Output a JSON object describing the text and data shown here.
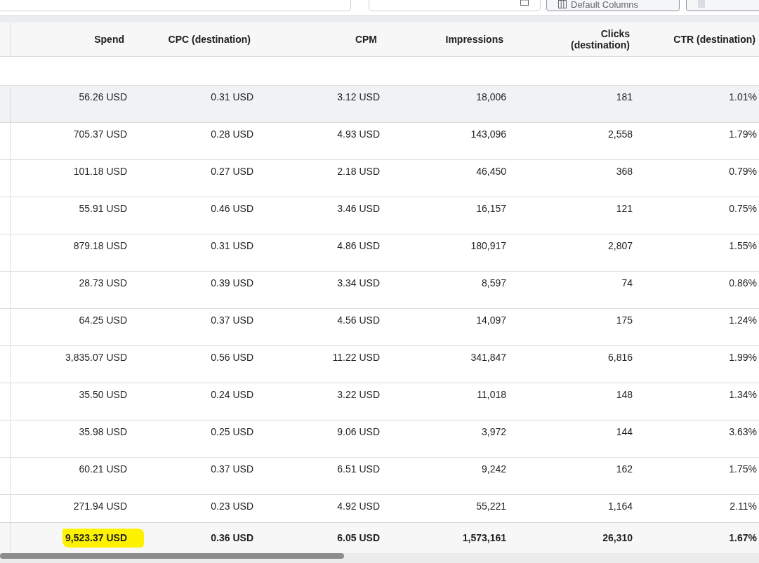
{
  "toolbar": {
    "columns_button": {
      "label": "Default Columns"
    }
  },
  "table": {
    "columns": [
      "Spend",
      "CPC (destination)",
      "CPM",
      "Impressions",
      "Clicks (destination)",
      "CTR (destination)"
    ],
    "rows": [
      {
        "selected": true,
        "cells": [
          "56.26 USD",
          "0.31 USD",
          "3.12 USD",
          "18,006",
          "181",
          "1.01%"
        ]
      },
      {
        "selected": false,
        "cells": [
          "705.37 USD",
          "0.28 USD",
          "4.93 USD",
          "143,096",
          "2,558",
          "1.79%"
        ]
      },
      {
        "selected": false,
        "cells": [
          "101.18 USD",
          "0.27 USD",
          "2.18 USD",
          "46,450",
          "368",
          "0.79%"
        ]
      },
      {
        "selected": false,
        "cells": [
          "55.91 USD",
          "0.46 USD",
          "3.46 USD",
          "16,157",
          "121",
          "0.75%"
        ]
      },
      {
        "selected": false,
        "cells": [
          "879.18 USD",
          "0.31 USD",
          "4.86 USD",
          "180,917",
          "2,807",
          "1.55%"
        ]
      },
      {
        "selected": false,
        "cells": [
          "28.73 USD",
          "0.39 USD",
          "3.34 USD",
          "8,597",
          "74",
          "0.86%"
        ]
      },
      {
        "selected": false,
        "cells": [
          "64.25 USD",
          "0.37 USD",
          "4.56 USD",
          "14,097",
          "175",
          "1.24%"
        ]
      },
      {
        "selected": false,
        "cells": [
          "3,835.07 USD",
          "0.56 USD",
          "11.22 USD",
          "341,847",
          "6,816",
          "1.99%"
        ]
      },
      {
        "selected": false,
        "cells": [
          "35.50 USD",
          "0.24 USD",
          "3.22 USD",
          "11,018",
          "148",
          "1.34%"
        ]
      },
      {
        "selected": false,
        "cells": [
          "35.98 USD",
          "0.25 USD",
          "9.06 USD",
          "3,972",
          "144",
          "3.63%"
        ]
      },
      {
        "selected": false,
        "cells": [
          "60.21 USD",
          "0.37 USD",
          "6.51 USD",
          "9,242",
          "162",
          "1.75%"
        ]
      },
      {
        "selected": false,
        "cells": [
          "271.94 USD",
          "0.23 USD",
          "4.92 USD",
          "55,221",
          "1,164",
          "2.11%"
        ]
      }
    ],
    "totals": {
      "cells": [
        {
          "text": "9,523.37 USD",
          "highlighted": true
        },
        {
          "text": "0.36 USD",
          "highlighted": false
        },
        {
          "text": "6.05 USD",
          "highlighted": false
        },
        {
          "text": "1,573,161",
          "highlighted": false
        },
        {
          "text": "26,310",
          "highlighted": false
        },
        {
          "text": "1.67%",
          "highlighted": false
        }
      ]
    }
  }
}
